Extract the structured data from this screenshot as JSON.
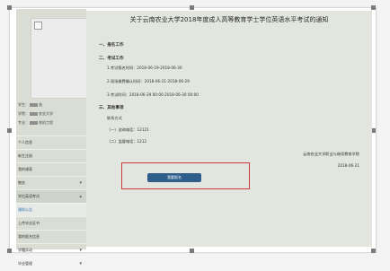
{
  "sidebar": {
    "student_info": [
      {
        "label": "学生：",
        "value": "洛"
      },
      {
        "label": "学院：",
        "value": "农业大学"
      },
      {
        "label": "专业：",
        "value": "农机工程"
      }
    ],
    "nav": [
      {
        "label": "个人信息"
      },
      {
        "label": "新生注册"
      },
      {
        "label": "我的课表"
      },
      {
        "label": "教务",
        "arrow": "▾"
      },
      {
        "label": "学位英语考试",
        "arrow": "▴"
      },
      {
        "label": "通知公告"
      },
      {
        "label": "上传毕业证书"
      },
      {
        "label": "我的报名信息"
      },
      {
        "label": "学籍异动",
        "arrow": "▾"
      },
      {
        "label": "毕业管理",
        "arrow": "▾"
      }
    ]
  },
  "notice": {
    "title": "关于云南农业大学2018年度成人高等教育学士学位英语水平考试的通知",
    "section1": "一、报名工作",
    "section2": "二、考试工作",
    "item1": "1.考试报名时间：2018-06-19-2018-06-30",
    "item2": "2.现场缴费确认时间：2018-06-21-2018-06-29",
    "item3": "3.考试时间：2018-06-29 00:00-2018-06-30 00:00",
    "section3": "三、其他事项",
    "contact_heading": "联系方式",
    "phone1": "（一）咨询电话：12121",
    "phone2": "（二）监督电话：1212",
    "org": "云南农业大学职业与继续教育学院",
    "date": "2018-06-21",
    "query_button": "我要报名"
  },
  "colors": {
    "sidebar_bg": "#d9ddd4",
    "content_bg": "#e3e6df",
    "button": "#2f5e8c",
    "highlight": "#cc3b3b",
    "selected_text": "#2b70b8"
  }
}
